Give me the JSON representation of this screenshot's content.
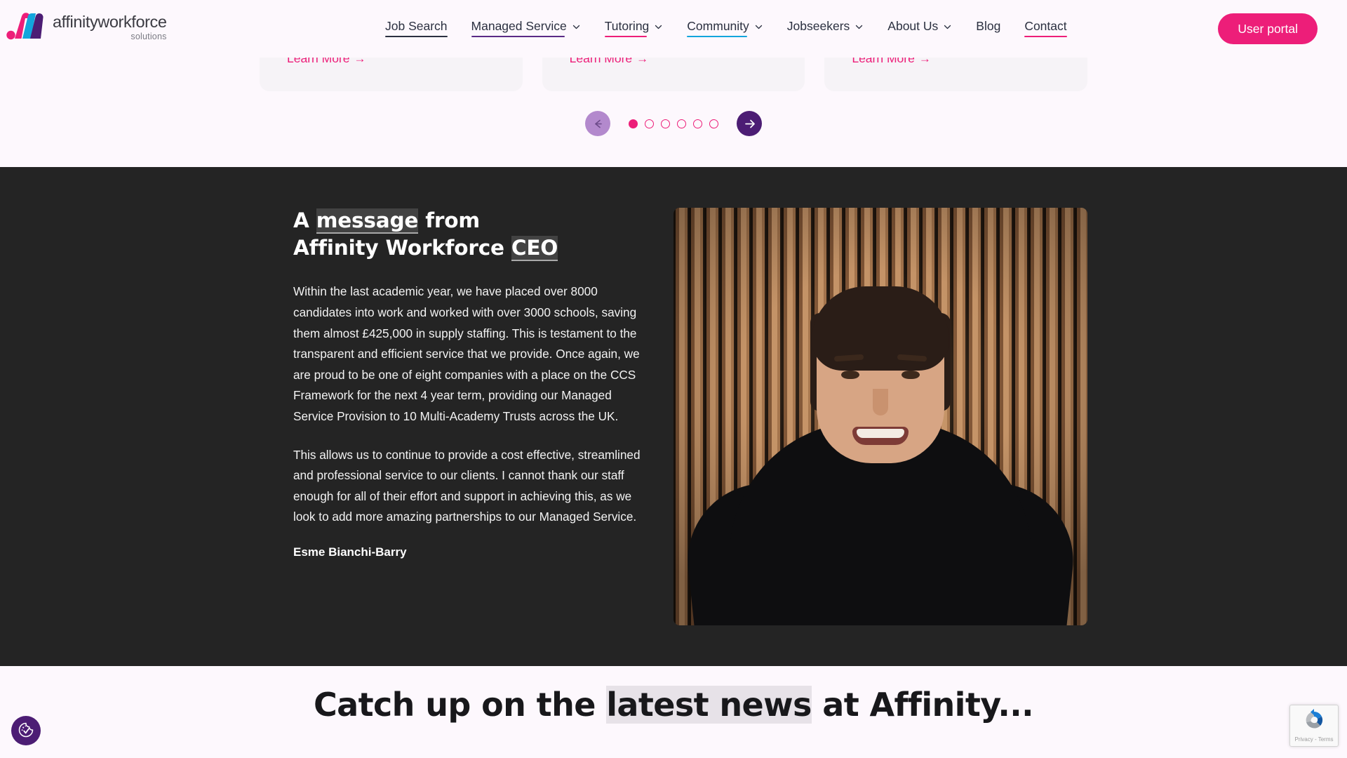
{
  "brand": {
    "name": "affinityworkforce",
    "tagline": "solutions",
    "colors": {
      "pink": "#ed1e79",
      "purple": "#4c1d74",
      "cyan": "#12a5dc",
      "dark": "#242424",
      "page_bg": "#fdf8fd"
    }
  },
  "header": {
    "nav_items": [
      {
        "label": "Job Search",
        "has_dropdown": false,
        "underline": "#2b3040"
      },
      {
        "label": "Managed Service",
        "has_dropdown": true,
        "underline": "#5b2a86"
      },
      {
        "label": "Tutoring",
        "has_dropdown": true,
        "underline": "#ed1e79"
      },
      {
        "label": "Community",
        "has_dropdown": true,
        "underline": "#12a5dc"
      },
      {
        "label": "Jobseekers",
        "has_dropdown": true,
        "underline": "none"
      },
      {
        "label": "About Us",
        "has_dropdown": true,
        "underline": "none"
      },
      {
        "label": "Blog",
        "has_dropdown": false,
        "underline": "none"
      },
      {
        "label": "Contact",
        "has_dropdown": false,
        "underline": "#ed1e79"
      }
    ],
    "portal_button": "User portal"
  },
  "carousel": {
    "cards": [
      {
        "link_label": "Learn More",
        "arrow": "→"
      },
      {
        "link_label": "Learn More",
        "arrow": "→"
      },
      {
        "link_label": "Learn More",
        "arrow": "→"
      }
    ],
    "dot_count": 6,
    "active_dot": 1,
    "prev_label": "Previous slide",
    "next_label": "Next slide",
    "prev_enabled": false,
    "next_enabled": true
  },
  "ceo_section": {
    "heading_line1_pre": "A ",
    "heading_line1_highlight": "message",
    "heading_line1_post": " from",
    "heading_line2_pre": "Affinity Workforce ",
    "heading_line2_highlight": "CEO",
    "paragraph_1": "Within the last academic year, we have placed over 8000 candidates into work and worked with over 3000 schools, saving them almost £425,000 in supply staffing. This is testament to the transparent and efficient service that we provide. Once again, we are proud to be one of eight companies with a place on the CCS Framework for the next 4 year term, providing our Managed Service Provision to 10 Multi-Academy Trusts across the UK.",
    "paragraph_2": "This allows us to continue to provide a cost effective, streamlined and professional service to our clients. I cannot thank our staff enough for all of their effort and support in achieving this, as we look to add more amazing partnerships to our Managed Service.",
    "signature": "Esme Bianchi-Barry",
    "photo_alt": "Portrait of Esme Bianchi-Barry in front of a wooden slat wall"
  },
  "news_section": {
    "heading_pre": "Catch up on the ",
    "heading_highlight": "latest news",
    "heading_post": " at Affinity..."
  },
  "widgets": {
    "accessibility_label": "Accessibility options",
    "recaptcha_label": "Privacy - Terms"
  }
}
